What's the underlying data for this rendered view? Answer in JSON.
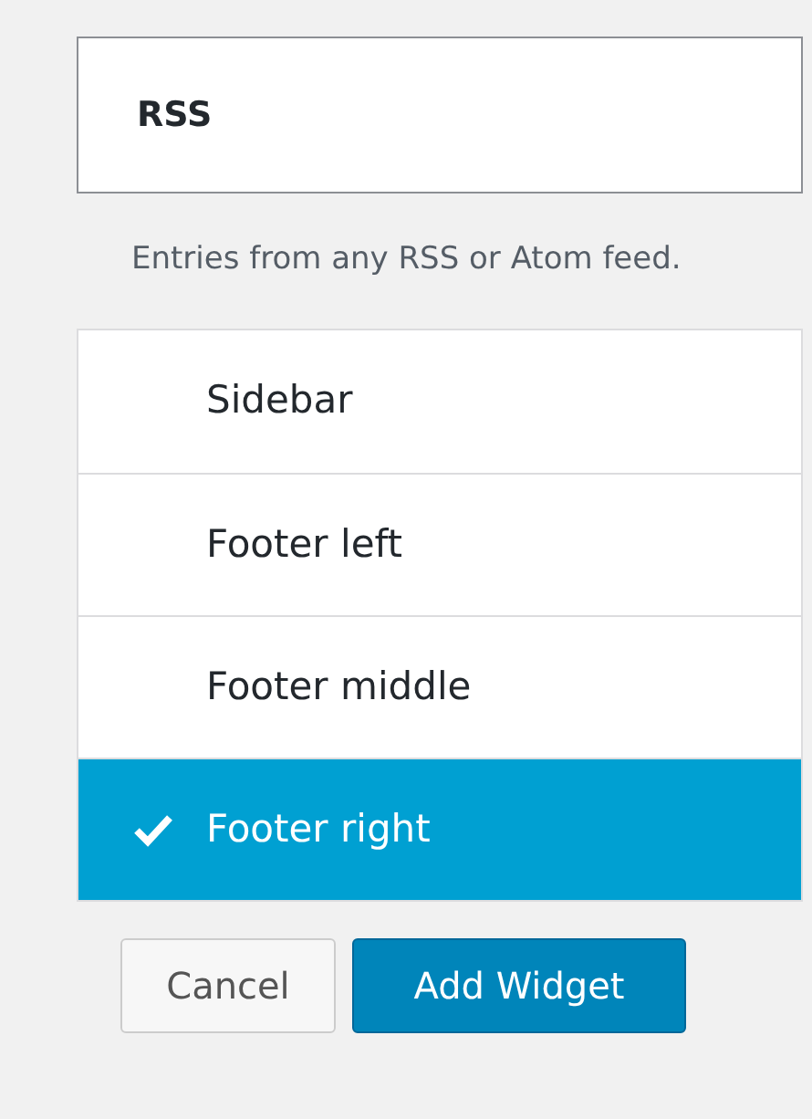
{
  "widget": {
    "title": "RSS",
    "description": "Entries from any RSS or Atom feed."
  },
  "areas": [
    {
      "label": "Sidebar",
      "selected": false
    },
    {
      "label": "Footer left",
      "selected": false
    },
    {
      "label": "Footer middle",
      "selected": false
    },
    {
      "label": "Footer right",
      "selected": true
    }
  ],
  "buttons": {
    "cancel": "Cancel",
    "add": "Add Widget"
  }
}
